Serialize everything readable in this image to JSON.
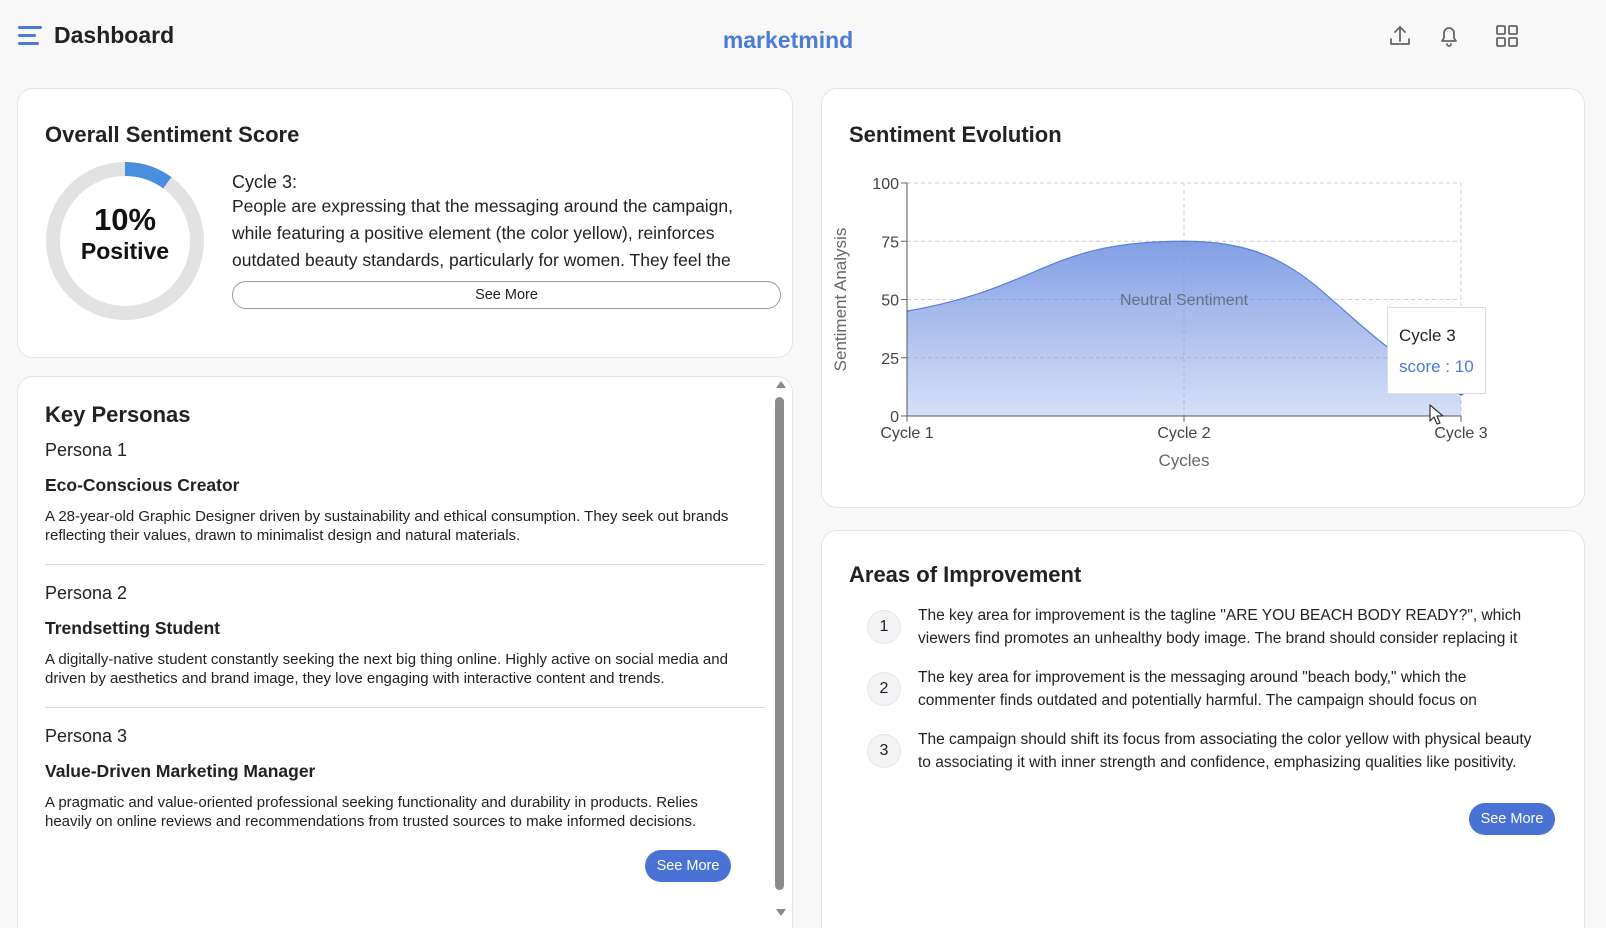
{
  "header": {
    "title": "Dashboard",
    "brand": "marketmind",
    "icons": [
      "menu-icon",
      "upload-icon",
      "bell-icon",
      "grid-icon"
    ]
  },
  "sentiment": {
    "title": "Overall Sentiment Score",
    "percent_label": "10%",
    "percent_value": 10,
    "sentiment_label": "Positive",
    "cycle_label": "Cycle 3:",
    "text": "People are expressing that the messaging around the campaign, while featuring a positive element (the color yellow), reinforces outdated beauty standards, particularly for women. They feel the campaign focuses on superficial appearances rather than inner qualities.",
    "button_label": "See More",
    "accent": "#4a8ee0"
  },
  "personas": {
    "title": "Key Personas",
    "items": [
      {
        "label": "Persona 1",
        "name": "Eco-Conscious Creator",
        "desc": "A 28-year-old Graphic Designer driven by sustainability and ethical consumption. They seek out brands reflecting their values, drawn to minimalist design and natural materials."
      },
      {
        "label": "Persona 2",
        "name": "Trendsetting Student",
        "desc": "A digitally-native student constantly seeking the next big thing online. Highly active on social media and driven by aesthetics and brand image, they love engaging with interactive content and trends."
      },
      {
        "label": "Persona 3",
        "name": "Value-Driven Marketing Manager",
        "desc": "A pragmatic and value-oriented professional seeking functionality and durability in products. Relies heavily on online reviews and recommendations from trusted sources to make informed decisions."
      }
    ],
    "button_label": "See More"
  },
  "evolution": {
    "title": "Sentiment Evolution",
    "tooltip_title": "Cycle 3",
    "tooltip_value": "score : 10"
  },
  "chart_data": {
    "type": "area",
    "title": "Sentiment Evolution",
    "categories": [
      "Cycle 1",
      "Cycle 2",
      "Cycle 3"
    ],
    "series": [
      {
        "values": [
          45,
          75,
          10
        ]
      }
    ],
    "xlabel": "Cycles",
    "ylabel": "Sentiment Analysis",
    "ylim": [
      0,
      100
    ],
    "yticks": [
      0,
      25,
      50,
      75,
      100
    ],
    "band_label": "Neutral Sentiment",
    "grid": true,
    "color": "#6d8fe0"
  },
  "improvement": {
    "title": "Areas of Improvement",
    "items": [
      {
        "num": "1",
        "text": "The key area for improvement is the tagline \"ARE YOU BEACH BODY READY?\", which viewers find promotes an unhealthy body image. The brand should consider replacing it with a more inclusive message."
      },
      {
        "num": "2",
        "text": "The key area for improvement is the messaging around \"beach body,\" which the commenter finds outdated and potentially harmful. The campaign should focus on promoting confidence for all."
      },
      {
        "num": "3",
        "text": "The campaign should shift its focus from associating the color yellow with physical beauty to associating it with inner strength and confidence, emphasizing qualities like positivity."
      }
    ],
    "button_label": "See More"
  }
}
